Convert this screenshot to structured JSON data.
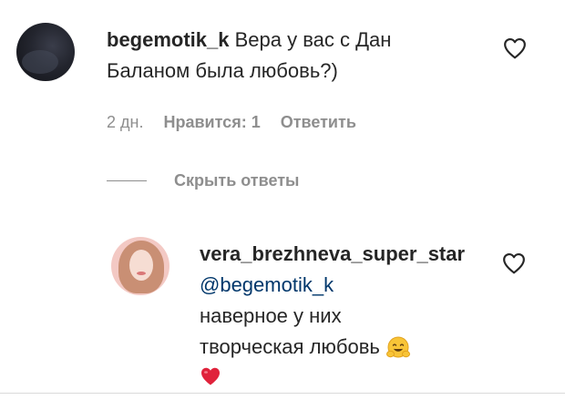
{
  "comment": {
    "username": "begemotik_k",
    "text_line1": "Вера у вас с Дан",
    "text_line2": "Баланом была любовь?)",
    "time": "2 дн.",
    "likes_label": "Нравится: 1",
    "reply_label": "Ответить"
  },
  "replies_toggle": {
    "label": "Скрыть ответы"
  },
  "reply": {
    "username": "vera_brezhneva_super_star",
    "mention": "@begemotik_k",
    "text_line1": "наверное у них",
    "text_line2": "творческая любовь"
  },
  "icons": {
    "like": "heart-outline-icon",
    "hug_emoji": "hugging-face-emoji",
    "red_heart": "red-heart-emoji"
  },
  "colors": {
    "text": "#262626",
    "secondary": "#8e8e8e",
    "mention": "#00376b"
  }
}
